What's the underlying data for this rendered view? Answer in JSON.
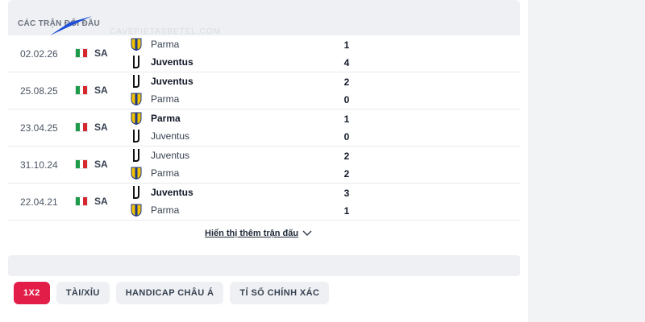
{
  "header": {
    "title": "CÁC TRẬN ĐỐI ĐẦU",
    "watermark": "CAVEPIETASBETEL.COM"
  },
  "colors": {
    "active_tab": "#e11d48",
    "juventus": "#111111",
    "parma": "#1f3a8a",
    "parma_accent": "#f2c200"
  },
  "matches": [
    {
      "date": "02.02.26",
      "competition": "SA",
      "flag_icon": "italy-flag-icon",
      "home": {
        "name": "Parma",
        "score": "1",
        "bold": false
      },
      "away": {
        "name": "Juventus",
        "score": "4",
        "bold": true
      }
    },
    {
      "date": "25.08.25",
      "competition": "SA",
      "flag_icon": "italy-flag-icon",
      "home": {
        "name": "Juventus",
        "score": "2",
        "bold": true
      },
      "away": {
        "name": "Parma",
        "score": "0",
        "bold": false
      }
    },
    {
      "date": "23.04.25",
      "competition": "SA",
      "flag_icon": "italy-flag-icon",
      "home": {
        "name": "Parma",
        "score": "1",
        "bold": true
      },
      "away": {
        "name": "Juventus",
        "score": "0",
        "bold": false
      }
    },
    {
      "date": "31.10.24",
      "competition": "SA",
      "flag_icon": "italy-flag-icon",
      "home": {
        "name": "Juventus",
        "score": "2",
        "bold": false
      },
      "away": {
        "name": "Parma",
        "score": "2",
        "bold": false
      }
    },
    {
      "date": "22.04.21",
      "competition": "SA",
      "flag_icon": "italy-flag-icon",
      "home": {
        "name": "Juventus",
        "score": "3",
        "bold": true
      },
      "away": {
        "name": "Parma",
        "score": "1",
        "bold": false
      }
    }
  ],
  "show_more": {
    "label": "Hiển thị thêm trận đấu"
  },
  "tabs": [
    {
      "label": "1X2",
      "active": true
    },
    {
      "label": "TÀI/XỈU",
      "active": false
    },
    {
      "label": "HANDICAP CHÂU Á",
      "active": false
    },
    {
      "label": "TỈ SỐ CHÍNH XÁC",
      "active": false
    }
  ]
}
